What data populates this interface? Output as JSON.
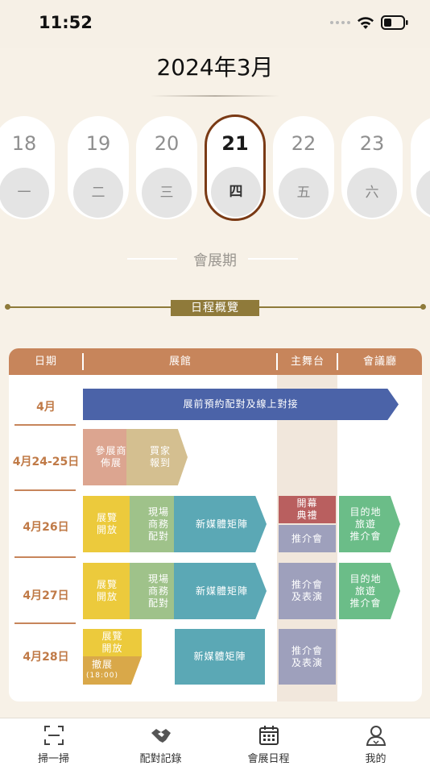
{
  "status_bar": {
    "time": "11:52"
  },
  "header": {
    "title": "2024年3月"
  },
  "days": [
    {
      "num": "18",
      "weekday": "一",
      "selected": false
    },
    {
      "num": "19",
      "weekday": "二",
      "selected": false
    },
    {
      "num": "20",
      "weekday": "三",
      "selected": false
    },
    {
      "num": "21",
      "weekday": "四",
      "selected": true
    },
    {
      "num": "22",
      "weekday": "五",
      "selected": false
    },
    {
      "num": "23",
      "weekday": "六",
      "selected": false
    }
  ],
  "period_label": "會展期",
  "overview": {
    "title": "日程概覽",
    "headers": {
      "date": "日期",
      "hall": "展館",
      "stage": "主舞台",
      "hall2": "會議廳"
    },
    "rows": [
      {
        "date": "4月"
      },
      {
        "date": "4月24-25日"
      },
      {
        "date": "4月26日"
      },
      {
        "date": "4月27日"
      },
      {
        "date": "4月28日"
      }
    ],
    "blocks": {
      "online_matching": "展前預約配對及線上對接",
      "exhibitor_setup": "參展商\n佈展",
      "buyer_checkin": "買家\n報到",
      "open_26": "展覽\n開放",
      "match_26": "現場\n商務\n配對",
      "media_26": "新媒體矩陣",
      "opening": "開幕\n典禮",
      "promo_26": "推介會",
      "dest_26": "目的地\n旅遊\n推介會",
      "open_27": "展覽\n開放",
      "match_27": "現場\n商務\n配對",
      "media_27": "新媒體矩陣",
      "promo_27": "推介會\n及表演",
      "dest_27": "目的地\n旅遊\n推介會",
      "open_28": "展覽\n開放",
      "teardown": "撤展",
      "teardown_time": "(18:00)",
      "media_28": "新媒體矩陣",
      "promo_28": "推介會\n及表演"
    }
  },
  "tabs": [
    {
      "label": "掃一掃",
      "icon": "scan-icon"
    },
    {
      "label": "配對記錄",
      "icon": "handshake-icon"
    },
    {
      "label": "會展日程",
      "icon": "calendar-icon"
    },
    {
      "label": "我的",
      "icon": "user-icon"
    }
  ],
  "colors": {
    "background": "#f7f1e7",
    "accent_brown": "#7a3a15",
    "header_orange": "#c7855b",
    "section_gold": "#8f7a3a",
    "blue": "#4b63a8",
    "pink": "#dca590",
    "tan": "#d4bf90",
    "yellow": "#ecca3c",
    "green_light": "#9fc28a",
    "teal": "#5ba8b5",
    "red": "#b95f5f",
    "slate": "#9ea0bc",
    "green": "#6bbd88",
    "gold": "#d9a849"
  }
}
